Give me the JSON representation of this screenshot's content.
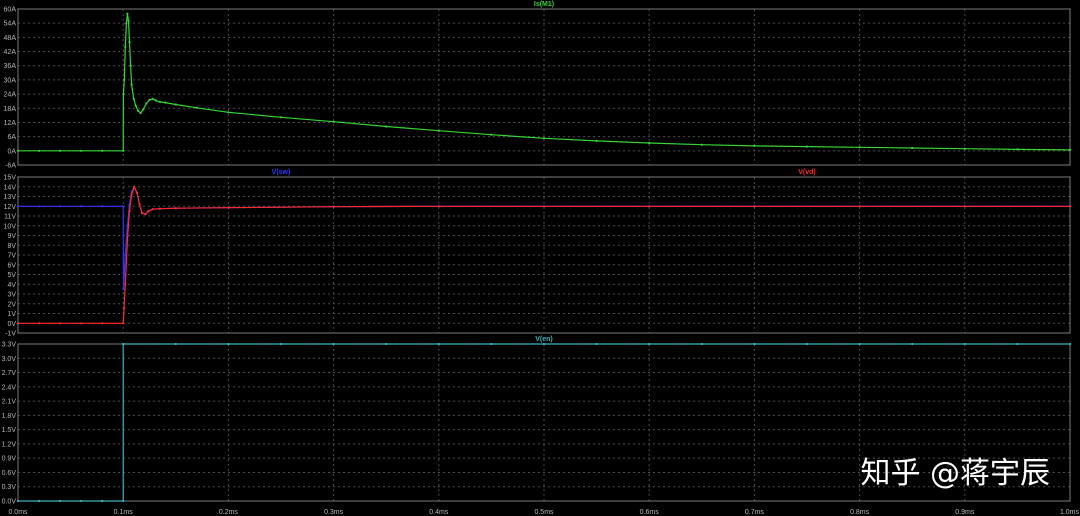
{
  "colors": {
    "background": "#000000",
    "frame": "#7a7a7a",
    "grid": "#4c4c4c",
    "axis_text": "#b8b8b8"
  },
  "watermark": {
    "text": "知乎 @蒋宇辰",
    "color": "#ffffff"
  },
  "chart_data": [
    {
      "type": "line",
      "xlim": [
        0,
        1.0
      ],
      "ylim": [
        -6,
        60
      ],
      "grid": true,
      "yticks": [
        {
          "value": 60,
          "label": "60A"
        },
        {
          "value": 54,
          "label": "54A"
        },
        {
          "value": 48,
          "label": "48A"
        },
        {
          "value": 42,
          "label": "42A"
        },
        {
          "value": 36,
          "label": "36A"
        },
        {
          "value": 30,
          "label": "30A"
        },
        {
          "value": 24,
          "label": "24A"
        },
        {
          "value": 18,
          "label": "18A"
        },
        {
          "value": 12,
          "label": "12A"
        },
        {
          "value": 6,
          "label": "6A"
        },
        {
          "value": 0,
          "label": "0A"
        },
        {
          "value": -6,
          "label": "-6A"
        }
      ],
      "series": [
        {
          "name": "Is(M1)",
          "color": "#36d636",
          "points": [
            [
              0,
              0
            ],
            [
              0.02,
              0
            ],
            [
              0.04,
              0
            ],
            [
              0.06,
              0
            ],
            [
              0.08,
              0
            ],
            [
              0.1,
              0
            ],
            [
              0.1002,
              24
            ],
            [
              0.101,
              30
            ],
            [
              0.102,
              44
            ],
            [
              0.103,
              54
            ],
            [
              0.104,
              58
            ],
            [
              0.105,
              55
            ],
            [
              0.106,
              46
            ],
            [
              0.107,
              36
            ],
            [
              0.108,
              28
            ],
            [
              0.11,
              22
            ],
            [
              0.112,
              19
            ],
            [
              0.114,
              17
            ],
            [
              0.1165,
              16
            ],
            [
              0.119,
              17.5
            ],
            [
              0.122,
              20
            ],
            [
              0.125,
              21.5
            ],
            [
              0.128,
              22
            ],
            [
              0.131,
              21.3
            ],
            [
              0.135,
              20.7
            ],
            [
              0.14,
              20.4
            ],
            [
              0.15,
              19.6
            ],
            [
              0.17,
              18.2
            ],
            [
              0.2,
              16.3
            ],
            [
              0.25,
              14.2
            ],
            [
              0.3,
              12.3
            ],
            [
              0.35,
              10.3
            ],
            [
              0.4,
              8.5
            ],
            [
              0.45,
              6.8
            ],
            [
              0.5,
              5.3
            ],
            [
              0.55,
              4.2
            ],
            [
              0.6,
              3.3
            ],
            [
              0.65,
              2.6
            ],
            [
              0.7,
              2.1
            ],
            [
              0.75,
              1.8
            ],
            [
              0.8,
              1.5
            ],
            [
              0.85,
              1.2
            ],
            [
              0.9,
              0.9
            ],
            [
              0.95,
              0.6
            ],
            [
              1.0,
              0.4
            ]
          ]
        }
      ]
    },
    {
      "type": "line",
      "xlim": [
        0,
        1.0
      ],
      "ylim": [
        -1,
        15
      ],
      "grid": true,
      "yticks": [
        {
          "value": 15,
          "label": "15V"
        },
        {
          "value": 14,
          "label": "14V"
        },
        {
          "value": 13,
          "label": "13V"
        },
        {
          "value": 12,
          "label": "12V"
        },
        {
          "value": 11,
          "label": "11V"
        },
        {
          "value": 10,
          "label": "10V"
        },
        {
          "value": 9,
          "label": "9V"
        },
        {
          "value": 8,
          "label": "8V"
        },
        {
          "value": 7,
          "label": "7V"
        },
        {
          "value": 6,
          "label": "6V"
        },
        {
          "value": 5,
          "label": "5V"
        },
        {
          "value": 4,
          "label": "4V"
        },
        {
          "value": 3,
          "label": "3V"
        },
        {
          "value": 2,
          "label": "2V"
        },
        {
          "value": 1,
          "label": "1V"
        },
        {
          "value": 0,
          "label": "0V"
        },
        {
          "value": -1,
          "label": "-1V"
        }
      ],
      "series": [
        {
          "name": "V(sw)",
          "color": "#3434ff",
          "points": [
            [
              0,
              12
            ],
            [
              0.02,
              12
            ],
            [
              0.04,
              12
            ],
            [
              0.06,
              12
            ],
            [
              0.08,
              12
            ],
            [
              0.1,
              12
            ],
            [
              0.1003,
              3.5
            ],
            [
              0.101,
              5
            ],
            [
              0.102,
              7
            ],
            [
              0.104,
              10
            ],
            [
              0.106,
              12.2
            ],
            [
              0.108,
              13.5
            ],
            [
              0.1105,
              14
            ],
            [
              0.113,
              13.4
            ],
            [
              0.1155,
              12.2
            ],
            [
              0.118,
              11.3
            ],
            [
              0.121,
              11.2
            ],
            [
              0.124,
              11.5
            ],
            [
              0.128,
              11.7
            ],
            [
              0.135,
              11.75
            ],
            [
              0.15,
              11.8
            ],
            [
              0.2,
              11.85
            ],
            [
              0.3,
              11.95
            ],
            [
              0.4,
              12
            ],
            [
              0.5,
              12
            ],
            [
              0.6,
              12
            ],
            [
              0.7,
              12
            ],
            [
              0.8,
              12
            ],
            [
              0.9,
              12
            ],
            [
              1.0,
              12
            ]
          ]
        },
        {
          "name": "V(vd)",
          "color": "#ff2a2a",
          "points": [
            [
              0,
              0
            ],
            [
              0.02,
              0
            ],
            [
              0.04,
              0
            ],
            [
              0.06,
              0
            ],
            [
              0.08,
              0
            ],
            [
              0.1,
              0
            ],
            [
              0.1008,
              1.5
            ],
            [
              0.102,
              4
            ],
            [
              0.104,
              8.5
            ],
            [
              0.106,
              11.5
            ],
            [
              0.108,
              13.2
            ],
            [
              0.1105,
              14
            ],
            [
              0.113,
              13.4
            ],
            [
              0.1155,
              12.2
            ],
            [
              0.118,
              11.3
            ],
            [
              0.121,
              11.2
            ],
            [
              0.124,
              11.5
            ],
            [
              0.128,
              11.7
            ],
            [
              0.135,
              11.75
            ],
            [
              0.15,
              11.8
            ],
            [
              0.2,
              11.85
            ],
            [
              0.3,
              11.95
            ],
            [
              0.4,
              12
            ],
            [
              0.5,
              12
            ],
            [
              0.6,
              12
            ],
            [
              0.7,
              12
            ],
            [
              0.8,
              12
            ],
            [
              0.9,
              12
            ],
            [
              1.0,
              12
            ]
          ]
        }
      ]
    },
    {
      "type": "line",
      "xlim": [
        0,
        1.0
      ],
      "ylim": [
        0,
        3.3
      ],
      "grid": true,
      "yticks": [
        {
          "value": 3.3,
          "label": "3.3V"
        },
        {
          "value": 3.0,
          "label": "3.0V"
        },
        {
          "value": 2.7,
          "label": "2.7V"
        },
        {
          "value": 2.4,
          "label": "2.4V"
        },
        {
          "value": 2.1,
          "label": "2.1V"
        },
        {
          "value": 1.8,
          "label": "1.8V"
        },
        {
          "value": 1.5,
          "label": "1.5V"
        },
        {
          "value": 1.2,
          "label": "1.2V"
        },
        {
          "value": 0.9,
          "label": "0.9V"
        },
        {
          "value": 0.6,
          "label": "0.6V"
        },
        {
          "value": 0.3,
          "label": "0.3V"
        },
        {
          "value": 0.0,
          "label": "0.0V"
        }
      ],
      "xticks": [
        {
          "value": 0.0,
          "label": "0.0ms"
        },
        {
          "value": 0.1,
          "label": "0.1ms"
        },
        {
          "value": 0.2,
          "label": "0.2ms"
        },
        {
          "value": 0.3,
          "label": "0.3ms"
        },
        {
          "value": 0.4,
          "label": "0.4ms"
        },
        {
          "value": 0.5,
          "label": "0.5ms"
        },
        {
          "value": 0.6,
          "label": "0.6ms"
        },
        {
          "value": 0.7,
          "label": "0.7ms"
        },
        {
          "value": 0.8,
          "label": "0.8ms"
        },
        {
          "value": 0.9,
          "label": "0.9ms"
        },
        {
          "value": 1.0,
          "label": "1.0ms"
        }
      ],
      "series": [
        {
          "name": "V(en)",
          "color": "#40b2b8",
          "points": [
            [
              0,
              0
            ],
            [
              0.02,
              0
            ],
            [
              0.04,
              0
            ],
            [
              0.06,
              0
            ],
            [
              0.08,
              0
            ],
            [
              0.1,
              0
            ],
            [
              0.1,
              3.3
            ],
            [
              0.15,
              3.3
            ],
            [
              0.2,
              3.3
            ],
            [
              0.25,
              3.3
            ],
            [
              0.3,
              3.3
            ],
            [
              0.35,
              3.3
            ],
            [
              0.4,
              3.3
            ],
            [
              0.45,
              3.3
            ],
            [
              0.5,
              3.3
            ],
            [
              0.55,
              3.3
            ],
            [
              0.6,
              3.3
            ],
            [
              0.65,
              3.3
            ],
            [
              0.7,
              3.3
            ],
            [
              0.75,
              3.3
            ],
            [
              0.8,
              3.3
            ],
            [
              0.85,
              3.3
            ],
            [
              0.9,
              3.3
            ],
            [
              0.95,
              3.3
            ],
            [
              1.0,
              3.3
            ]
          ]
        }
      ]
    }
  ]
}
